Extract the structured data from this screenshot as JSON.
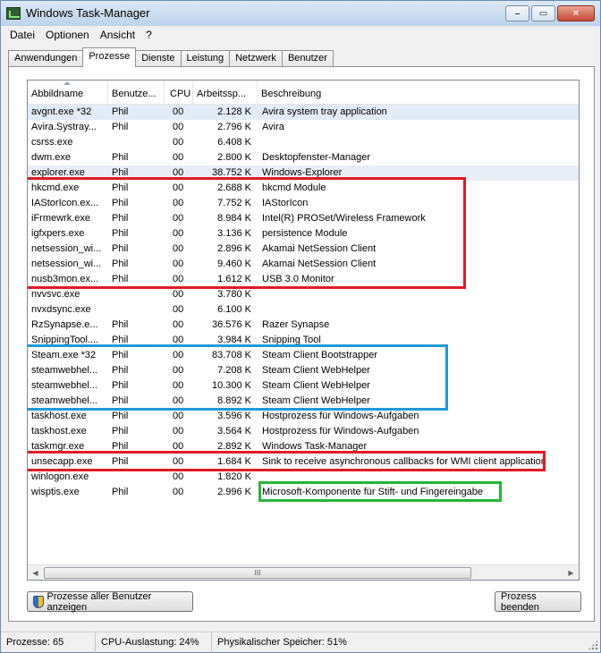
{
  "window": {
    "title": "Windows Task-Manager",
    "buttons": [
      "–",
      "▭",
      "✕"
    ]
  },
  "menu": [
    "Datei",
    "Optionen",
    "Ansicht",
    "?"
  ],
  "tabs": [
    {
      "label": "Anwendungen",
      "active": false
    },
    {
      "label": "Prozesse",
      "active": true
    },
    {
      "label": "Dienste",
      "active": false
    },
    {
      "label": "Leistung",
      "active": false
    },
    {
      "label": "Netzwerk",
      "active": false
    },
    {
      "label": "Benutzer",
      "active": false
    }
  ],
  "columns": [
    "Abbildname",
    "Benutze...",
    "CPU",
    "Arbeitssp...",
    "Beschreibung"
  ],
  "processes": [
    {
      "name": "avgnt.exe *32",
      "user": "Phil",
      "cpu": "00",
      "mem": "2.128 K",
      "desc": "Avira system tray application"
    },
    {
      "name": "Avira.Systray...",
      "user": "Phil",
      "cpu": "00",
      "mem": "2.796 K",
      "desc": "Avira"
    },
    {
      "name": "csrss.exe",
      "user": "",
      "cpu": "00",
      "mem": "6.408 K",
      "desc": ""
    },
    {
      "name": "dwm.exe",
      "user": "Phil",
      "cpu": "00",
      "mem": "2.800 K",
      "desc": "Desktopfenster-Manager"
    },
    {
      "name": "explorer.exe",
      "user": "Phil",
      "cpu": "00",
      "mem": "38.752 K",
      "desc": "Windows-Explorer"
    },
    {
      "name": "hkcmd.exe",
      "user": "Phil",
      "cpu": "00",
      "mem": "2.688 K",
      "desc": "hkcmd Module"
    },
    {
      "name": "IAStorIcon.ex...",
      "user": "Phil",
      "cpu": "00",
      "mem": "7.752 K",
      "desc": "IAStorIcon"
    },
    {
      "name": "iFrmewrk.exe",
      "user": "Phil",
      "cpu": "00",
      "mem": "8.984 K",
      "desc": "Intel(R) PROSet/Wireless Framework"
    },
    {
      "name": "igfxpers.exe",
      "user": "Phil",
      "cpu": "00",
      "mem": "3.136 K",
      "desc": "persistence Module"
    },
    {
      "name": "netsession_wi...",
      "user": "Phil",
      "cpu": "00",
      "mem": "2.896 K",
      "desc": "Akamai NetSession Client"
    },
    {
      "name": "netsession_wi...",
      "user": "Phil",
      "cpu": "00",
      "mem": "9.460 K",
      "desc": "Akamai NetSession Client"
    },
    {
      "name": "nusb3mon.ex...",
      "user": "Phil",
      "cpu": "00",
      "mem": "1.612 K",
      "desc": "USB 3.0 Monitor"
    },
    {
      "name": "nvvsvc.exe",
      "user": "",
      "cpu": "00",
      "mem": "3.780 K",
      "desc": ""
    },
    {
      "name": "nvxdsync.exe",
      "user": "",
      "cpu": "00",
      "mem": "6.100 K",
      "desc": ""
    },
    {
      "name": "RzSynapse.e...",
      "user": "Phil",
      "cpu": "00",
      "mem": "36.576 K",
      "desc": "Razer Synapse"
    },
    {
      "name": "SnippingTool....",
      "user": "Phil",
      "cpu": "00",
      "mem": "3.984 K",
      "desc": "Snipping Tool"
    },
    {
      "name": "Steam.exe *32",
      "user": "Phil",
      "cpu": "00",
      "mem": "83.708 K",
      "desc": "Steam Client Bootstrapper"
    },
    {
      "name": "steamwebhel...",
      "user": "Phil",
      "cpu": "00",
      "mem": "7.208 K",
      "desc": "Steam Client WebHelper"
    },
    {
      "name": "steamwebhel...",
      "user": "Phil",
      "cpu": "00",
      "mem": "10.300 K",
      "desc": "Steam Client WebHelper"
    },
    {
      "name": "steamwebhel...",
      "user": "Phil",
      "cpu": "00",
      "mem": "8.892 K",
      "desc": "Steam Client WebHelper"
    },
    {
      "name": "taskhost.exe",
      "user": "Phil",
      "cpu": "00",
      "mem": "3.596 K",
      "desc": "Hostprozess für Windows-Aufgaben"
    },
    {
      "name": "taskhost.exe",
      "user": "Phil",
      "cpu": "00",
      "mem": "3.564 K",
      "desc": "Hostprozess für Windows-Aufgaben"
    },
    {
      "name": "taskmgr.exe",
      "user": "Phil",
      "cpu": "00",
      "mem": "2.892 K",
      "desc": "Windows Task-Manager"
    },
    {
      "name": "unsecapp.exe",
      "user": "Phil",
      "cpu": "00",
      "mem": "1.684 K",
      "desc": "Sink to receive asynchronous callbacks for WMI client application"
    },
    {
      "name": "winlogon.exe",
      "user": "",
      "cpu": "00",
      "mem": "1.820 K",
      "desc": ""
    },
    {
      "name": "wisptis.exe",
      "user": "Phil",
      "cpu": "00",
      "mem": "2.996 K",
      "desc": "Microsoft-Komponente für Stift- und Fingereingabe"
    }
  ],
  "scrollbar": {
    "thumb_grip": "III"
  },
  "buttons": {
    "show_all": "Prozesse aller Benutzer anzeigen",
    "end_process": "Prozess beenden"
  },
  "status": {
    "processes": "Prozesse: 65",
    "cpu": "CPU-Auslastung: 24%",
    "memory": "Physikalischer Speicher: 51%"
  },
  "highlights": {
    "red": "#e01b24",
    "blue": "#1d9ad6",
    "green": "#27b43a"
  }
}
